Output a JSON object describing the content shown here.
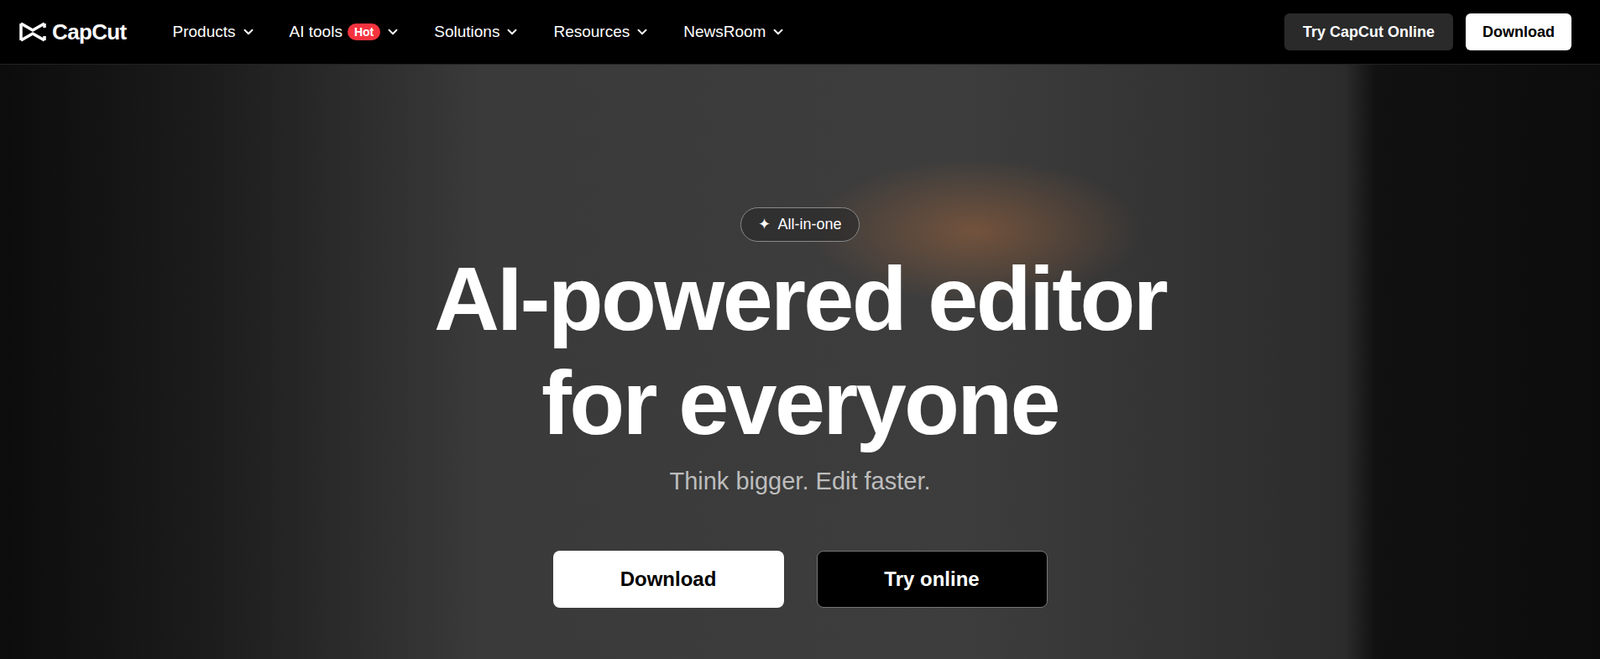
{
  "nav": {
    "logo": "CapCut",
    "items": [
      {
        "label": "Products"
      },
      {
        "label": "AI tools",
        "badge": "Hot"
      },
      {
        "label": "Solutions"
      },
      {
        "label": "Resources"
      },
      {
        "label": "NewsRoom"
      }
    ],
    "actions": [
      {
        "label": "Try CapCut Online",
        "kind": "dark"
      },
      {
        "label": "Download",
        "kind": "light"
      }
    ]
  },
  "hero": {
    "badge_icon": "✦",
    "badge": "All-in-one",
    "headline": [
      "AI-powered editor",
      "for everyone"
    ],
    "subtitle": "Think bigger. Edit faster.",
    "buttons": [
      {
        "label": "Download",
        "kind": "light"
      },
      {
        "label": "Try online",
        "kind": "dark"
      }
    ]
  }
}
